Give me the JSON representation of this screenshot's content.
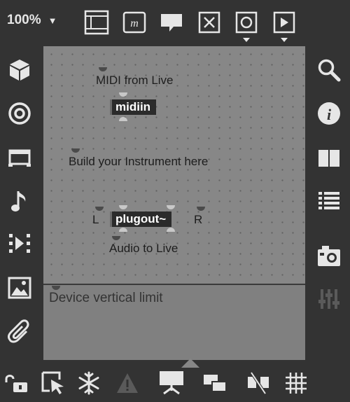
{
  "toolbar": {
    "zoom": "100%",
    "zoom_caret": "▼",
    "icons": [
      "presentation-mode-icon",
      "max-object-icon",
      "comment-icon",
      "close-box-icon",
      "circle-dropdown-icon",
      "play-dropdown-icon"
    ]
  },
  "left_sidebar": {
    "icons": [
      "cube-icon",
      "target-icon",
      "device-icon",
      "music-note-icon",
      "media-icon",
      "image-icon",
      "paperclip-icon"
    ]
  },
  "right_sidebar": {
    "icons": [
      "search-icon",
      "info-icon",
      "book-icon",
      "list-icon",
      "snapshot-icon",
      "sliders-icon"
    ]
  },
  "bottom_bar": {
    "icons": [
      "lock-icon",
      "select-arrow-icon",
      "freeze-icon",
      "warning-icon",
      "presentation-icon",
      "layers-icon",
      "patch-cords-icon",
      "grid-icon"
    ]
  },
  "canvas": {
    "comment_midi": "MIDI from Live",
    "midiin": "midiin",
    "comment_build": "Build your Instrument here",
    "label_L": "L",
    "plugout": "plugout~",
    "label_R": "R",
    "comment_audio": "Audio to Live",
    "device_limit": "Device vertical limit"
  },
  "colors": {
    "background": "#333333",
    "canvas": "#878787",
    "object_box": "#2b2b2b",
    "icon_light": "#e6e6e6",
    "icon_dim": "#5a5a5a"
  }
}
